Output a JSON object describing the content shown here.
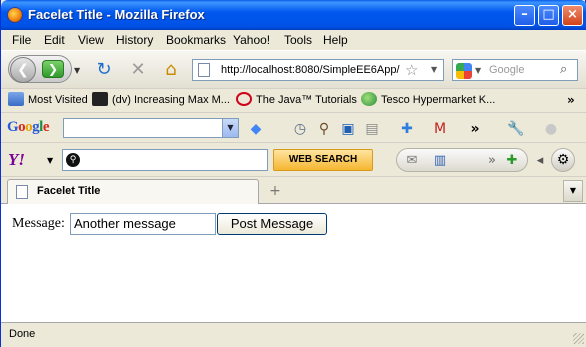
{
  "window": {
    "title": "Facelet Title - Mozilla Firefox",
    "controls": {
      "minimize": "–",
      "maximize": "□",
      "close": "×"
    }
  },
  "menu": [
    "File",
    "Edit",
    "View",
    "History",
    "Bookmarks",
    "Yahoo!",
    "Tools",
    "Help"
  ],
  "nav": {
    "back_icon": "back-arrow-icon",
    "forward_icon": "forward-arrow-icon",
    "url": "http://localhost:8080/SimpleEE6App/",
    "search_placeholder": "Google"
  },
  "bookmarks": {
    "items": [
      {
        "label": "Most Visited",
        "icon": "bookmarks-folder-icon"
      },
      {
        "label": "(dv) Increasing Max M...",
        "icon": "mt-site-icon"
      },
      {
        "label": "The Java™ Tutorials",
        "icon": "java-icon"
      },
      {
        "label": "Tesco Hypermarket K...",
        "icon": "globe-icon"
      }
    ],
    "more": "»"
  },
  "google_toolbar": {
    "logo": "Google",
    "more": "»"
  },
  "yahoo_toolbar": {
    "logo": "Y!",
    "search_button": "WEB SEARCH"
  },
  "tabs": [
    {
      "title": "Facelet Title",
      "active": true
    }
  ],
  "content": {
    "label": "Message:",
    "input_value": "Another message",
    "button": "Post Message"
  },
  "status": "Done"
}
